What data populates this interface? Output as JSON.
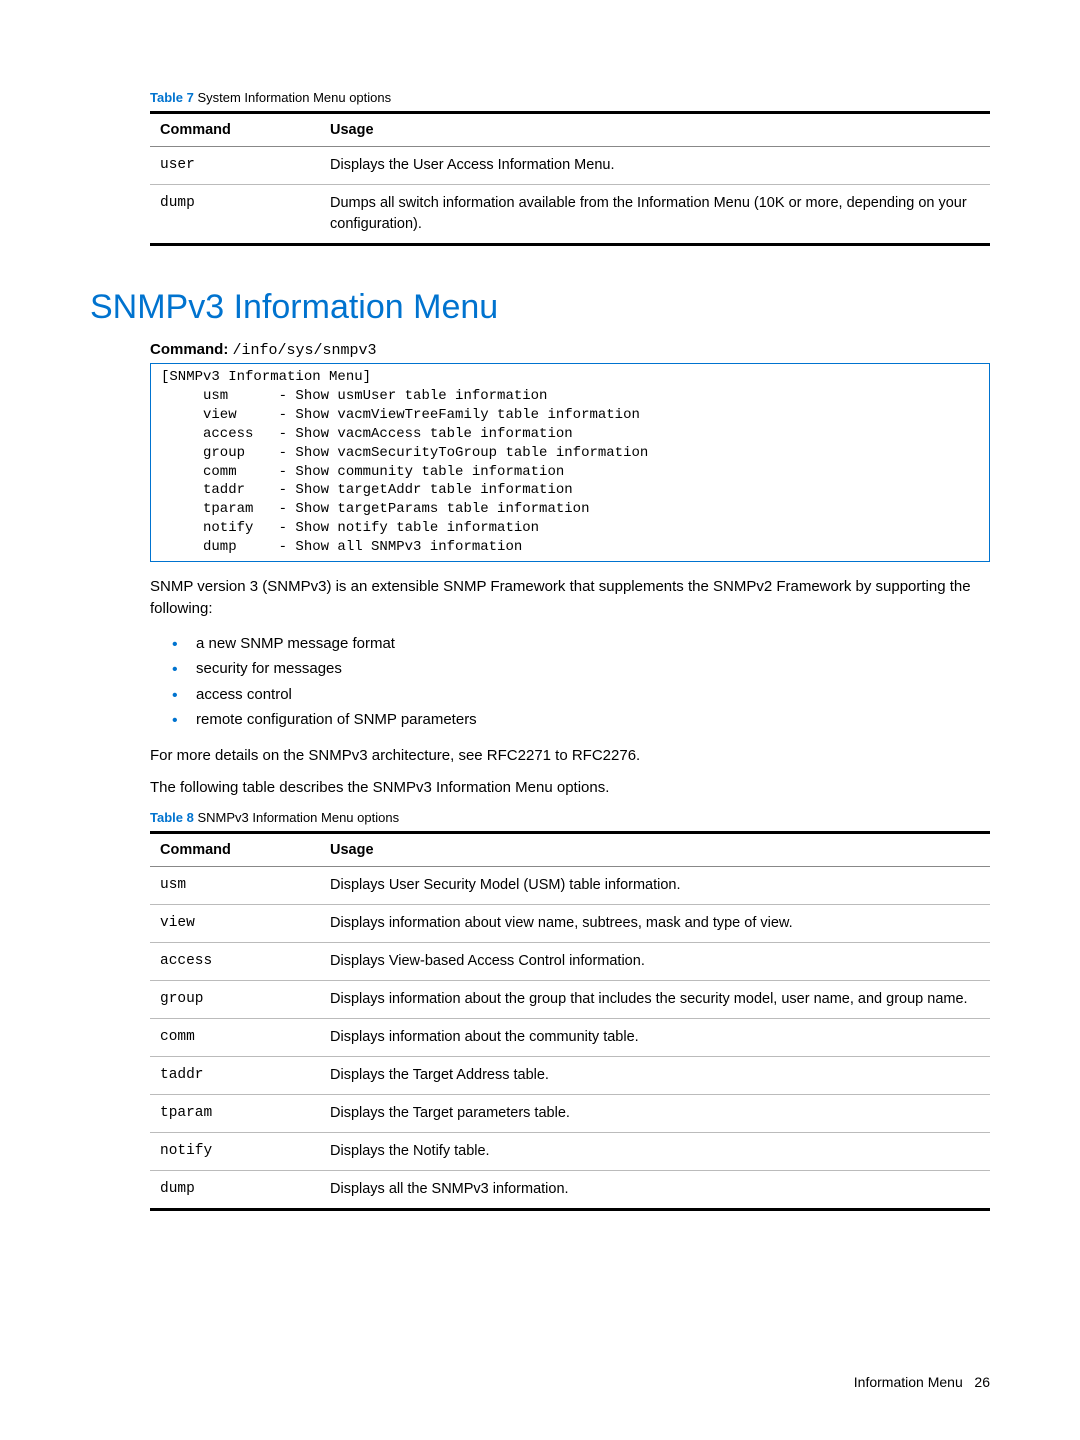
{
  "table7": {
    "caption_prefix": "Table 7",
    "caption_text": "System Information Menu options",
    "headers": [
      "Command",
      "Usage"
    ],
    "rows": [
      {
        "cmd": "user",
        "usage": "Displays the User Access Information Menu."
      },
      {
        "cmd": "dump",
        "usage": "Dumps all switch information available from the Information Menu (10K or more, depending on your configuration)."
      }
    ]
  },
  "section_title": "SNMPv3 Information Menu",
  "command_label": "Command:",
  "command_path": "/info/sys/snmpv3",
  "codebox": "[SNMPv3 Information Menu]\n     usm      - Show usmUser table information\n     view     - Show vacmViewTreeFamily table information\n     access   - Show vacmAccess table information\n     group    - Show vacmSecurityToGroup table information\n     comm     - Show community table information\n     taddr    - Show targetAddr table information\n     tparam   - Show targetParams table information\n     notify   - Show notify table information\n     dump     - Show all SNMPv3 information",
  "para1": "SNMP version 3 (SNMPv3) is an extensible SNMP Framework that supplements the SNMPv2 Framework by supporting the following:",
  "bullets": [
    "a new SNMP message format",
    "security for messages",
    "access control",
    "remote configuration of SNMP parameters"
  ],
  "para2": "For more details on the SNMPv3 architecture, see RFC2271 to RFC2276.",
  "para3": "The following table describes the SNMPv3 Information Menu options.",
  "table8": {
    "caption_prefix": "Table 8",
    "caption_text": "SNMPv3 Information Menu options",
    "headers": [
      "Command",
      "Usage"
    ],
    "rows": [
      {
        "cmd": "usm",
        "usage": "Displays User Security Model (USM) table information."
      },
      {
        "cmd": "view",
        "usage": "Displays information about view name, subtrees, mask and type of view."
      },
      {
        "cmd": "access",
        "usage": "Displays View-based Access Control information."
      },
      {
        "cmd": "group",
        "usage": "Displays information about the group that includes the security model, user name, and group name."
      },
      {
        "cmd": "comm",
        "usage": "Displays information about the community table."
      },
      {
        "cmd": "taddr",
        "usage": "Displays the Target Address table."
      },
      {
        "cmd": "tparam",
        "usage": "Displays the Target parameters table."
      },
      {
        "cmd": "notify",
        "usage": "Displays the Notify table."
      },
      {
        "cmd": "dump",
        "usage": "Displays all the SNMPv3 information."
      }
    ]
  },
  "footer": {
    "text": "Information Menu",
    "page": "26"
  }
}
